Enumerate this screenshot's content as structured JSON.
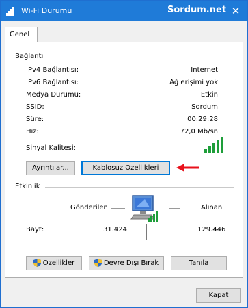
{
  "window": {
    "title": "Wi-Fi Durumu",
    "watermark": "Sordum.net",
    "close_glyph": "✕"
  },
  "tabs": [
    {
      "label": "Genel",
      "active": true
    }
  ],
  "connection": {
    "section_title": "Bağlantı",
    "rows": [
      {
        "label": "IPv4 Bağlantısı:",
        "value": "Internet"
      },
      {
        "label": "IPv6 Bağlantısı:",
        "value": "Ağ erişimi yok"
      },
      {
        "label": "Medya Durumu:",
        "value": "Etkin"
      },
      {
        "label": "SSID:",
        "value": "Sordum"
      },
      {
        "label": "Süre:",
        "value": "00:29:28"
      },
      {
        "label": "Hız:",
        "value": "72,0 Mb/sn"
      }
    ],
    "signal_label": "Sinyal Kalitesi:",
    "signal_level": 5,
    "signal_max": 5,
    "signal_color": "#1e9e3a",
    "details_button": "Ayrıntılar...",
    "wireless_props_button": "Kablosuz Özellikleri",
    "arrow_color": "#e8111b"
  },
  "activity": {
    "section_title": "Etkinlik",
    "sent_label": "Gönderilen",
    "received_label": "Alınan",
    "bytes_label": "Bayt:",
    "bytes_sent": "31.424",
    "bytes_received": "129.446"
  },
  "actions": {
    "properties_button": "Özellikler",
    "disable_button": "Devre Dışı Bırak",
    "diagnose_button": "Tanıla"
  },
  "footer": {
    "close_button": "Kapat"
  },
  "colors": {
    "titlebar": "#1f7bd8",
    "accent_border": "#0078d7",
    "shield_blue": "#2d6bc4",
    "shield_yellow": "#f2c12e"
  },
  "icons": {
    "app": "wifi-signal-icon",
    "network": "network-computer-icon",
    "shield": "uac-shield-icon",
    "arrow": "red-arrow-icon"
  }
}
